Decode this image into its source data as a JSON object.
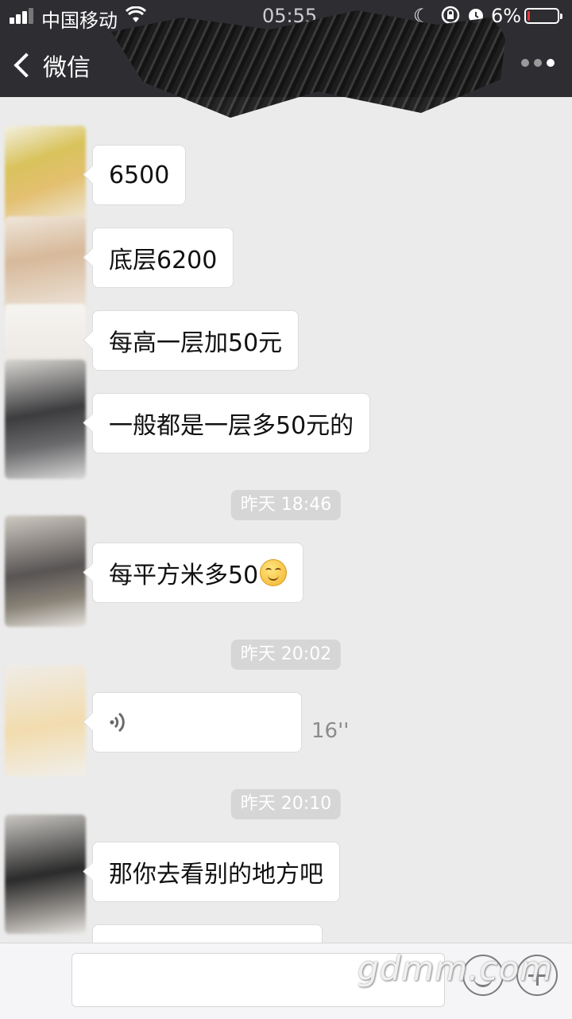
{
  "status_bar": {
    "carrier": "中国移动",
    "time": "05:55",
    "battery_percent": "6%",
    "battery_level": 0.06
  },
  "nav": {
    "back_label": "微信"
  },
  "messages": [
    {
      "type": "text",
      "text": "6500"
    },
    {
      "type": "text",
      "text": "底层6200"
    },
    {
      "type": "text",
      "text": "每高一层加50元"
    },
    {
      "type": "text",
      "text": "一般都是一层多50元的"
    },
    {
      "type": "timestamp",
      "text": "昨天 18:46"
    },
    {
      "type": "text",
      "text": "每平方米多50",
      "emoji": "smiling-face"
    },
    {
      "type": "timestamp",
      "text": "昨天 20:02"
    },
    {
      "type": "voice",
      "duration": "16''"
    },
    {
      "type": "timestamp",
      "text": "昨天 20:10"
    },
    {
      "type": "text",
      "text": "那你去看别的地方吧"
    }
  ],
  "watermark": "gdmm.com",
  "colors": {
    "header_bg": "#2e2d32",
    "chat_bg": "#ebebeb",
    "bubble_bg": "#ffffff",
    "battery_low": "#e23b3b"
  }
}
